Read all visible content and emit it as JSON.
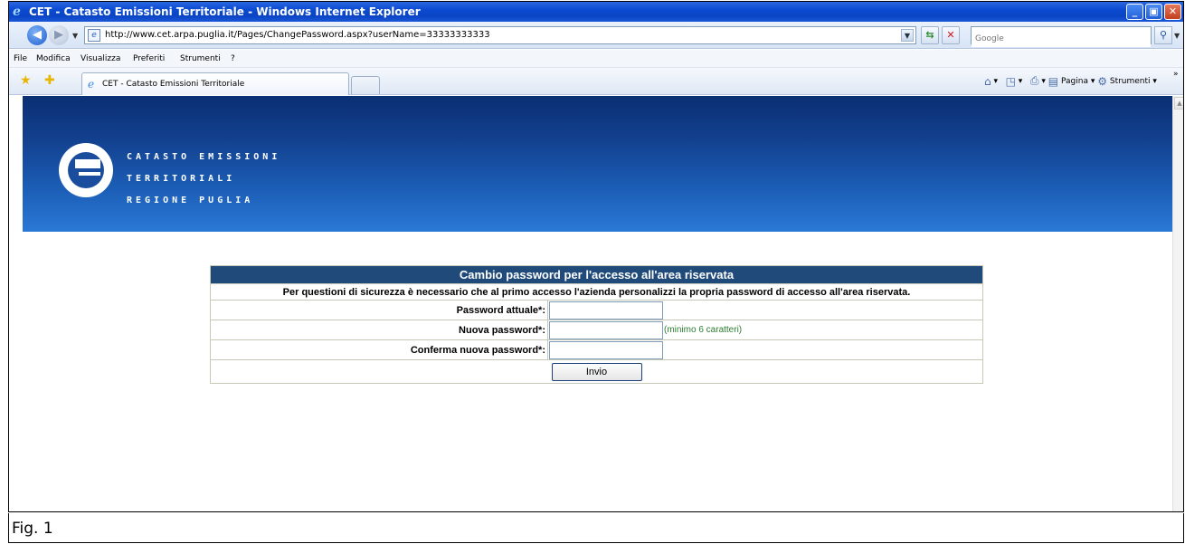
{
  "window": {
    "title": "CET - Catasto Emissioni Territoriale - Windows Internet Explorer"
  },
  "addressbar": {
    "url": "http://www.cet.arpa.puglia.it/Pages/ChangePassword.aspx?userName=33333333333",
    "search_placeholder": "Google"
  },
  "menu": {
    "items": [
      "File",
      "Modifica",
      "Visualizza",
      "Preferiti",
      "Strumenti",
      "?"
    ]
  },
  "tabs": {
    "active_label": "CET - Catasto Emissioni Territoriale"
  },
  "commandbar": {
    "page_label": "Pagina",
    "tools_label": "Strumenti"
  },
  "banner": {
    "line1": "CATASTO EMISSIONI",
    "line2": "TERRITORIALI",
    "line3": "REGIONE PUGLIA"
  },
  "form": {
    "heading": "Cambio password per l'accesso all'area riservata",
    "info": "Per questioni di sicurezza è necessario che al primo accesso l'azienda personalizzi la propria password di accesso all'area riservata.",
    "current_password_label": "Password attuale*:",
    "new_password_label": "Nuova password*:",
    "new_password_hint": "(minimo 6 caratteri)",
    "confirm_password_label": "Conferma nuova password*:",
    "submit_label": "Invio"
  },
  "caption": "Fig. 1"
}
